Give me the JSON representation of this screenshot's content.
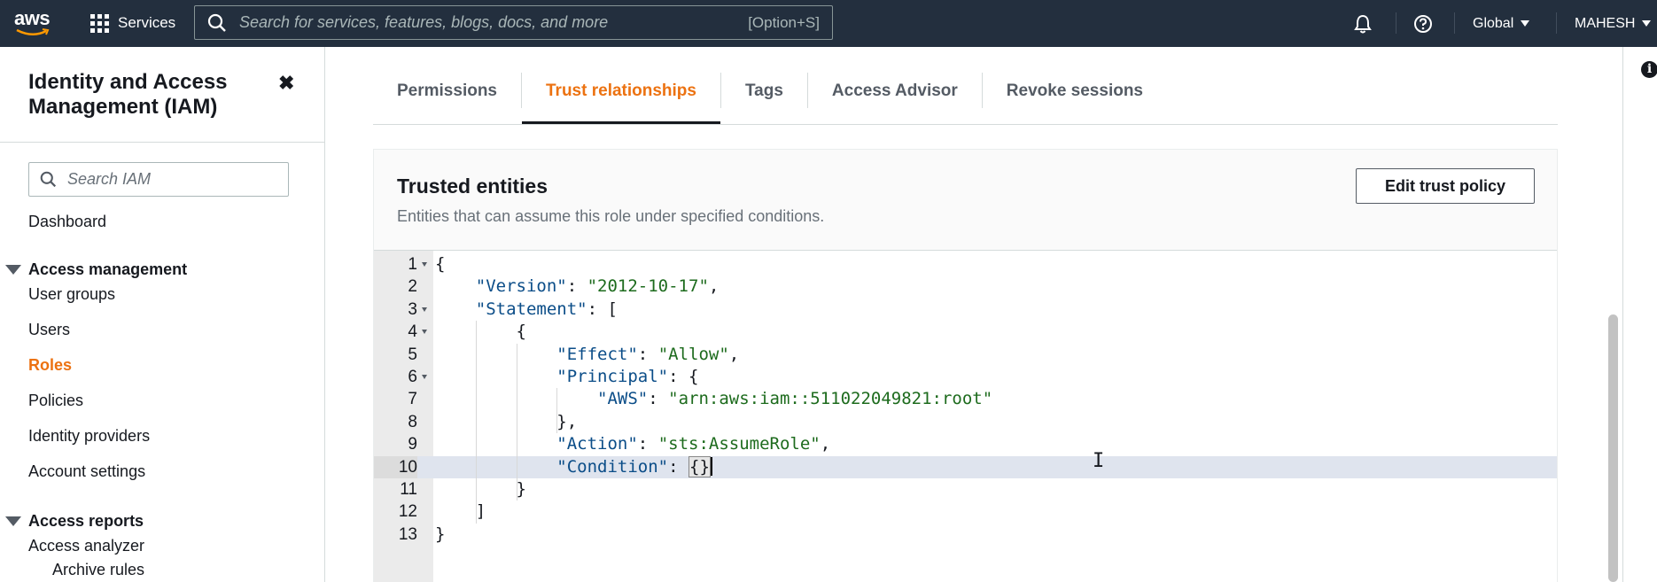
{
  "topnav": {
    "logo_text": "aws",
    "services_label": "Services",
    "search_placeholder": "Search for services, features, blogs, docs, and more",
    "search_shortcut": "[Option+S]",
    "region": "Global",
    "account": "MAHESH"
  },
  "sidebar": {
    "title": "Identity and Access Management (IAM)",
    "close_glyph": "✖",
    "search_placeholder": "Search IAM",
    "dashboard": "Dashboard",
    "access_management": {
      "heading": "Access management",
      "items": [
        "User groups",
        "Users",
        "Roles",
        "Policies",
        "Identity providers",
        "Account settings"
      ],
      "active": "Roles"
    },
    "access_reports": {
      "heading": "Access reports",
      "items": [
        "Access analyzer",
        "Archive rules"
      ]
    }
  },
  "tabs": [
    {
      "label": "Permissions"
    },
    {
      "label": "Trust relationships",
      "active": true
    },
    {
      "label": "Tags"
    },
    {
      "label": "Access Advisor"
    },
    {
      "label": "Revoke sessions"
    }
  ],
  "panel": {
    "title": "Trusted entities",
    "description": "Entities that can assume this role under specified conditions.",
    "edit_button": "Edit trust policy"
  },
  "editor": {
    "active_line": 10,
    "lines": [
      {
        "n": "1",
        "text": "{"
      },
      {
        "n": "2",
        "text": "    \"Version\": \"2012-10-17\","
      },
      {
        "n": "3",
        "text": "    \"Statement\": ["
      },
      {
        "n": "4",
        "text": "        {"
      },
      {
        "n": "5",
        "text": "            \"Effect\": \"Allow\","
      },
      {
        "n": "6",
        "text": "            \"Principal\": {"
      },
      {
        "n": "7",
        "text": "                \"AWS\": \"arn:aws:iam::511022049821:root\""
      },
      {
        "n": "8",
        "text": "            },"
      },
      {
        "n": "9",
        "text": "            \"Action\": \"sts:AssumeRole\","
      },
      {
        "n": "10",
        "text": "            \"Condition\": {}"
      },
      {
        "n": "11",
        "text": "        }"
      },
      {
        "n": "12",
        "text": "    ]"
      },
      {
        "n": "13",
        "text": "}"
      }
    ]
  },
  "colors": {
    "nav_bg": "#232f3e",
    "accent": "#ec7211",
    "json_key": "#0b4d88",
    "json_string": "#1d6b1d"
  }
}
